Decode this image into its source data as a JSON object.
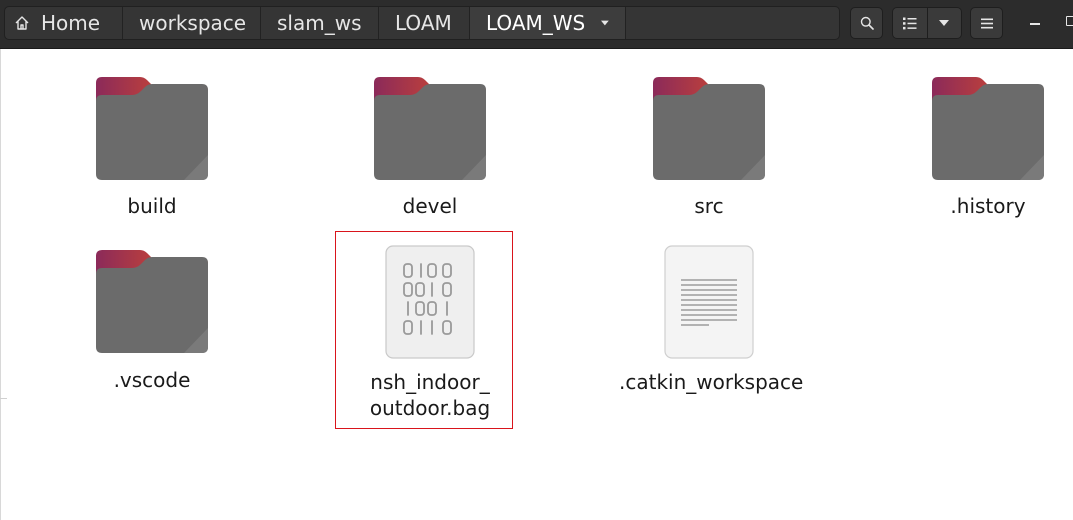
{
  "breadcrumb": [
    {
      "label": "Home",
      "icon": "home-icon"
    },
    {
      "label": "workspace"
    },
    {
      "label": "slam_ws"
    },
    {
      "label": "LOAM"
    },
    {
      "label": "LOAM_WS"
    }
  ],
  "toolbar": {
    "search_icon": "search-icon",
    "view_icon": "list-view-icon",
    "view_menu_icon": "chevron-down-icon",
    "menu_icon": "hamburger-menu-icon"
  },
  "files": [
    {
      "name": "build",
      "type": "folder"
    },
    {
      "name": "devel",
      "type": "folder"
    },
    {
      "name": "src",
      "type": "folder"
    },
    {
      "name": ".history",
      "type": "folder"
    },
    {
      "name": ".vscode",
      "type": "folder"
    },
    {
      "name": "nsh_indoor_\noutdoor.bag",
      "type": "binary",
      "selected": true
    },
    {
      "name": ".catkin_workspace",
      "type": "text"
    }
  ],
  "colors": {
    "folder_body": "#6b6b6b",
    "folder_tab_start": "#8b2a5a",
    "folder_tab_end": "#e95420",
    "selection_outline": "#d9141b",
    "headerbar": "#2c2c2c"
  }
}
